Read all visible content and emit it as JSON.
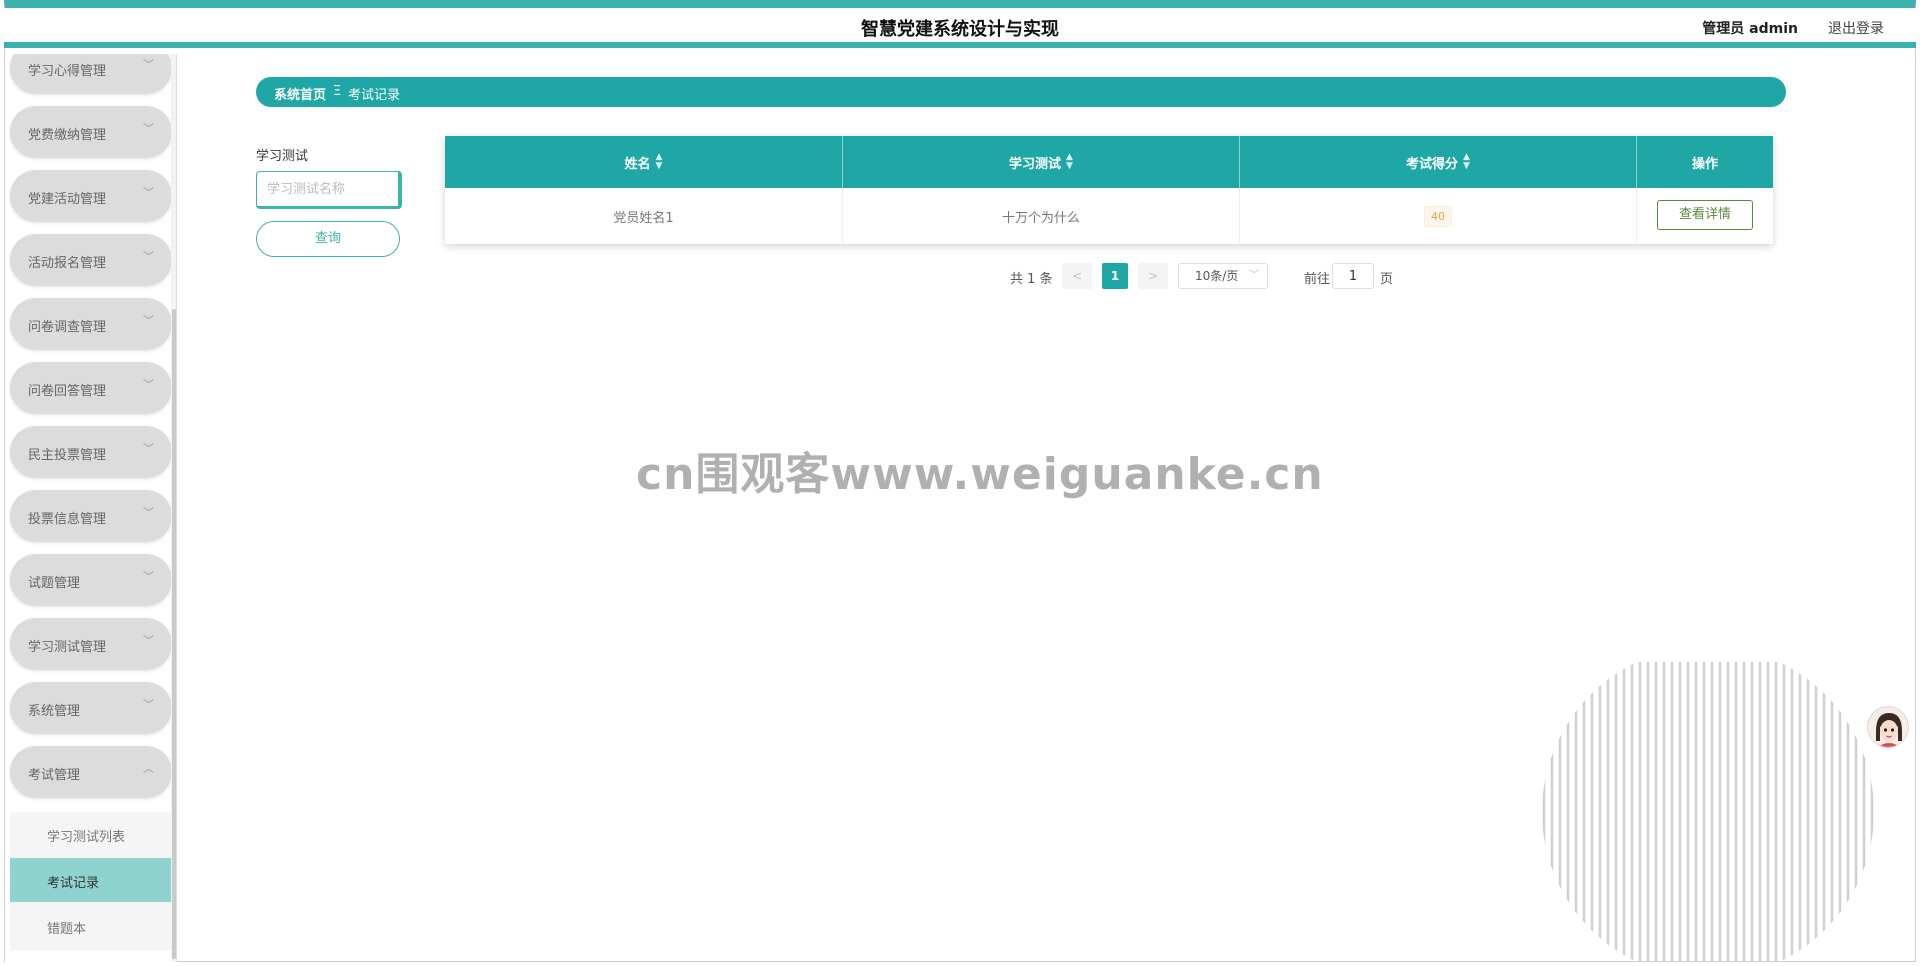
{
  "header": {
    "title": "智慧党建系统设计与实现",
    "user": "管理员 admin",
    "logout": "退出登录"
  },
  "sidebar": {
    "items": [
      {
        "label": "学习心得管理"
      },
      {
        "label": "党费缴纳管理"
      },
      {
        "label": "党建活动管理"
      },
      {
        "label": "活动报名管理"
      },
      {
        "label": "问卷调查管理"
      },
      {
        "label": "问卷回答管理"
      },
      {
        "label": "民主投票管理"
      },
      {
        "label": "投票信息管理"
      },
      {
        "label": "试题管理"
      },
      {
        "label": "学习测试管理"
      },
      {
        "label": "系统管理"
      },
      {
        "label": "考试管理"
      }
    ],
    "submenu": [
      {
        "label": "学习测试列表"
      },
      {
        "label": "考试记录"
      },
      {
        "label": "错题本"
      }
    ]
  },
  "breadcrumb": {
    "home": "系统首页",
    "separator": "Ξ",
    "current": "考试记录"
  },
  "search": {
    "label": "学习测试",
    "placeholder": "学习测试名称",
    "button": "查询"
  },
  "table": {
    "columns": [
      "姓名",
      "学习测试",
      "考试得分",
      "操作"
    ],
    "rows": [
      {
        "name": "党员姓名1",
        "test": "十万个为什么",
        "score": "40",
        "action": "查看详情"
      }
    ]
  },
  "pagination": {
    "total": "共 1 条",
    "prev": "<",
    "page": "1",
    "next": ">",
    "page_size": "10条/页",
    "goto_label": "前往",
    "goto_value": "1",
    "goto_suffix": "页"
  },
  "watermark": "cn围观客www.weiguanke.cn",
  "colors": {
    "accent": "#1ea7a5",
    "border_top": "#3bb3ac",
    "submenu_active": "#8fd3d0"
  }
}
